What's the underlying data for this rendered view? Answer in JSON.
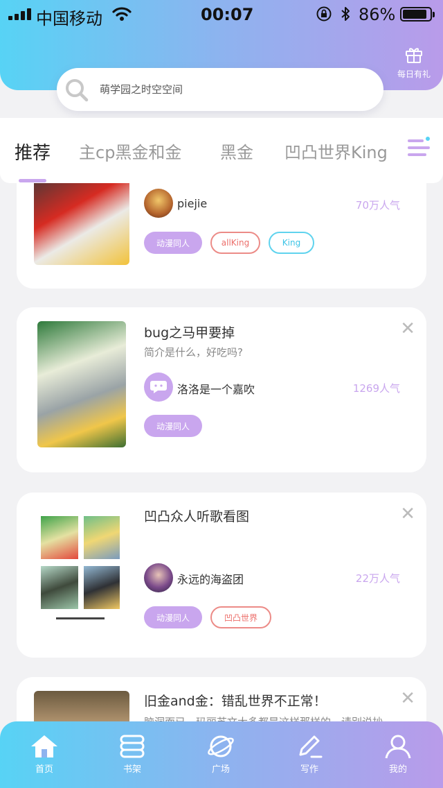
{
  "status": {
    "carrier": "中国移动",
    "time": "00:07",
    "battery": "86%"
  },
  "header": {
    "gift_label": "每日有礼"
  },
  "search": {
    "placeholder": "萌学园之时空空间"
  },
  "tabs": [
    {
      "label": "推荐",
      "active": true
    },
    {
      "label": "主cp黑金和金"
    },
    {
      "label": "黑金"
    },
    {
      "label": "凹凸世界King"
    }
  ],
  "cards": [
    {
      "title": "",
      "desc": "",
      "author": "piejie",
      "popularity": "70万人气",
      "tags": [
        "动漫同人",
        "allKing",
        "King"
      ]
    },
    {
      "title": "bug之马甲要掉",
      "desc": "简介是什么，好吃吗?",
      "author": "洛洛是一个嘉吹",
      "popularity": "1269人气",
      "tags": [
        "动漫同人"
      ]
    },
    {
      "title": "凹凸众人听歌看图",
      "desc": "",
      "author": "永远的海盗团",
      "popularity": "22万人气",
      "tags": [
        "动漫同人",
        "凹凸世界"
      ]
    },
    {
      "title": "旧金and金：错乱世界不正常！",
      "desc": "脑洞而已，玛丽苏文大多都是这样那样的，请别说抄",
      "author": "",
      "popularity": "",
      "tags": []
    }
  ],
  "nav": [
    {
      "label": "首页",
      "icon": "home-icon"
    },
    {
      "label": "书架",
      "icon": "bookshelf-icon"
    },
    {
      "label": "广场",
      "icon": "planet-icon"
    },
    {
      "label": "写作",
      "icon": "pen-icon"
    },
    {
      "label": "我的",
      "icon": "user-icon"
    }
  ],
  "colors": {
    "gradient_start": "#57d3f5",
    "gradient_end": "#b99bea",
    "accent": "#c9a6ee"
  }
}
